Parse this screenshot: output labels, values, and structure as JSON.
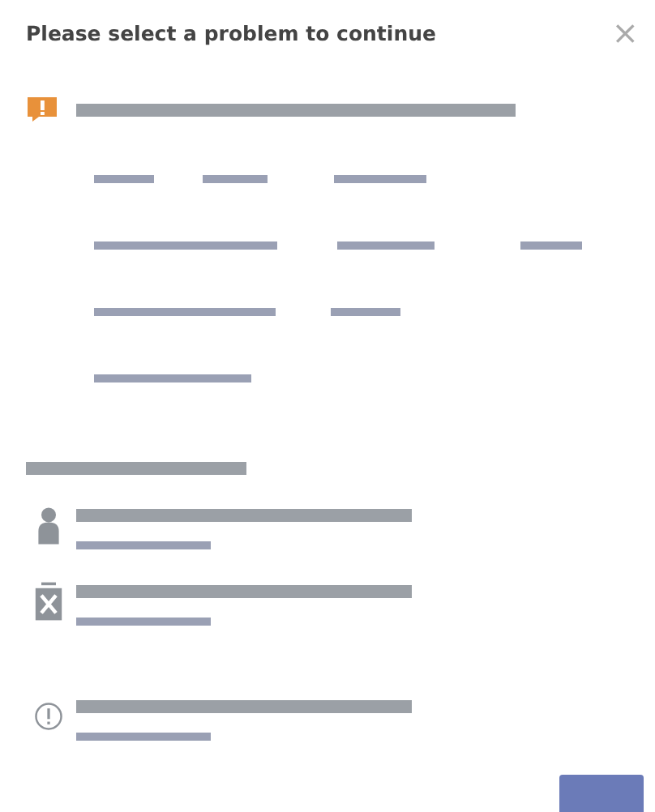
{
  "dialog": {
    "title": "Please select a problem to continue",
    "close_icon": "×"
  },
  "notice": {
    "kind": "warning",
    "text": {
      "kind": "redacted"
    }
  },
  "options": [
    [
      {
        "kind": "redacted"
      },
      {
        "kind": "redacted"
      },
      {
        "kind": "redacted"
      }
    ],
    [
      {
        "kind": "redacted"
      },
      {
        "kind": "redacted"
      },
      {
        "kind": "redacted"
      }
    ],
    [
      {
        "kind": "redacted"
      },
      {
        "kind": "redacted"
      }
    ],
    [
      {
        "kind": "redacted"
      }
    ]
  ],
  "section_heading": {
    "kind": "redacted"
  },
  "issues": [
    {
      "kind": "person",
      "title": {
        "kind": "redacted"
      },
      "subtitle": {
        "kind": "redacted"
      }
    },
    {
      "kind": "bin",
      "title": {
        "kind": "redacted"
      },
      "subtitle": {
        "kind": "redacted"
      }
    },
    {
      "kind": "info",
      "title": {
        "kind": "redacted"
      },
      "subtitle": {
        "kind": "redacted"
      }
    }
  ],
  "footer": {
    "button": {
      "kind": "redacted"
    }
  }
}
